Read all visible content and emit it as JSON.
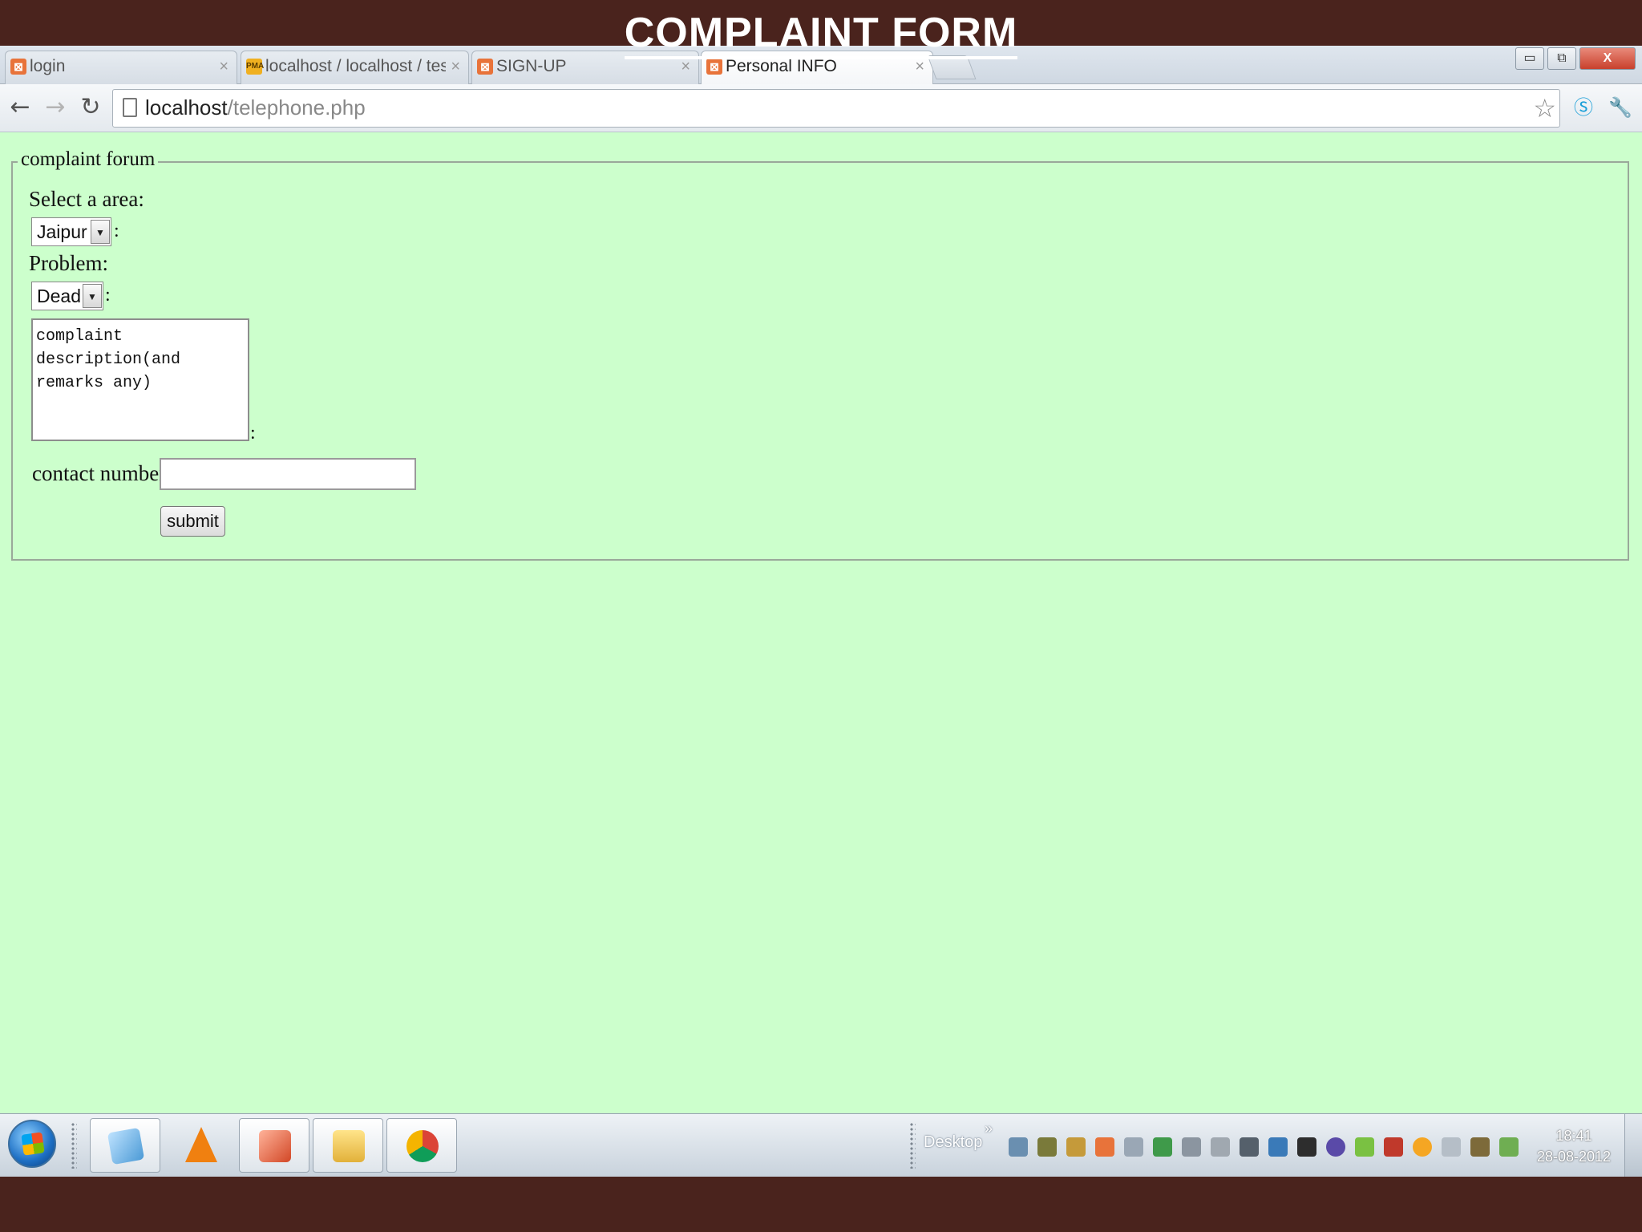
{
  "slide": {
    "title": "COMPLAINT FORM"
  },
  "browser": {
    "tabs": [
      {
        "label": "login",
        "close": "×"
      },
      {
        "label": "localhost / localhost / test",
        "close": "×"
      },
      {
        "label": "SIGN-UP",
        "close": "×"
      },
      {
        "label": "Personal INFO",
        "close": "×",
        "active": true
      }
    ],
    "window_controls": {
      "minimize": "▭",
      "maximize": "⧉",
      "close": "X"
    },
    "url_host": "localhost",
    "url_path": "/telephone.php",
    "icons": [
      "back-arrow-icon",
      "forward-arrow-icon",
      "reload-icon",
      "page-icon",
      "star-icon",
      "skype-icon",
      "wrench-icon"
    ]
  },
  "form": {
    "legend": "complaint forum",
    "area_label": "Select a area:",
    "area_value": "Jaipur",
    "problem_label": "Problem:",
    "problem_value": "Dead",
    "description_text": "complaint\ndescription(and\nremarks any)",
    "colon": ":",
    "contact_label": "contact number :",
    "contact_value": "",
    "submit_label": "submit"
  },
  "taskbar": {
    "desktop_label": "Desktop",
    "chevron": "»",
    "time": "18:41",
    "date": "28-08-2012"
  },
  "colors": {
    "slide_background": "#4a231d",
    "page_background": "#ccffcc",
    "favicon_orange": "#e8733a"
  }
}
